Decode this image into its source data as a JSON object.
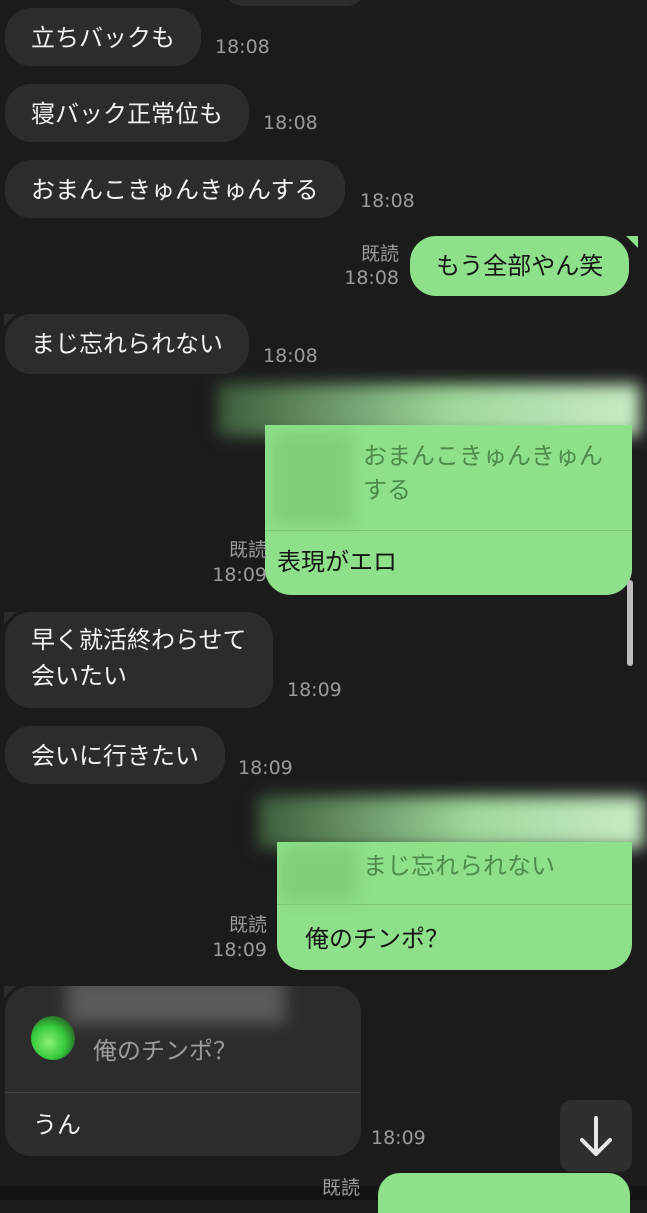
{
  "messages": {
    "m0": {
      "text": "立ちバックも",
      "time": "18:08"
    },
    "m1": {
      "text": "寝バック正常位も",
      "time": "18:08"
    },
    "m2": {
      "text": "おまんこきゅんきゅんする",
      "time": "18:08"
    },
    "m3": {
      "text": "もう全部やん笑",
      "read": "既読",
      "time": "18:08"
    },
    "m4": {
      "text": "まじ忘れられない",
      "time": "18:08"
    },
    "m5": {
      "quote_line1": "おまんこきゅんきゅん",
      "quote_line2": "する",
      "text": "表現がエロ",
      "read": "既読",
      "time": "18:09"
    },
    "m6": {
      "line1": "早く就活終わらせて",
      "line2": "会いたい",
      "time": "18:09"
    },
    "m7": {
      "text": "会いに行きたい",
      "time": "18:09"
    },
    "m8": {
      "quote": "まじ忘れられない",
      "text": "俺のチンポ？",
      "read": "既読",
      "time": "18:09"
    },
    "m9": {
      "quote": "俺のチンポ？",
      "text": "うん",
      "time": "18:09"
    },
    "m10": {
      "read": "既読"
    }
  },
  "scroll_button": {
    "icon": "arrow-down-icon"
  },
  "colors": {
    "background": "#1b1b1b",
    "incoming_bubble": "#2c2c2c",
    "outgoing_bubble": "#8fe08a",
    "meta_text": "#9b9b9b"
  }
}
